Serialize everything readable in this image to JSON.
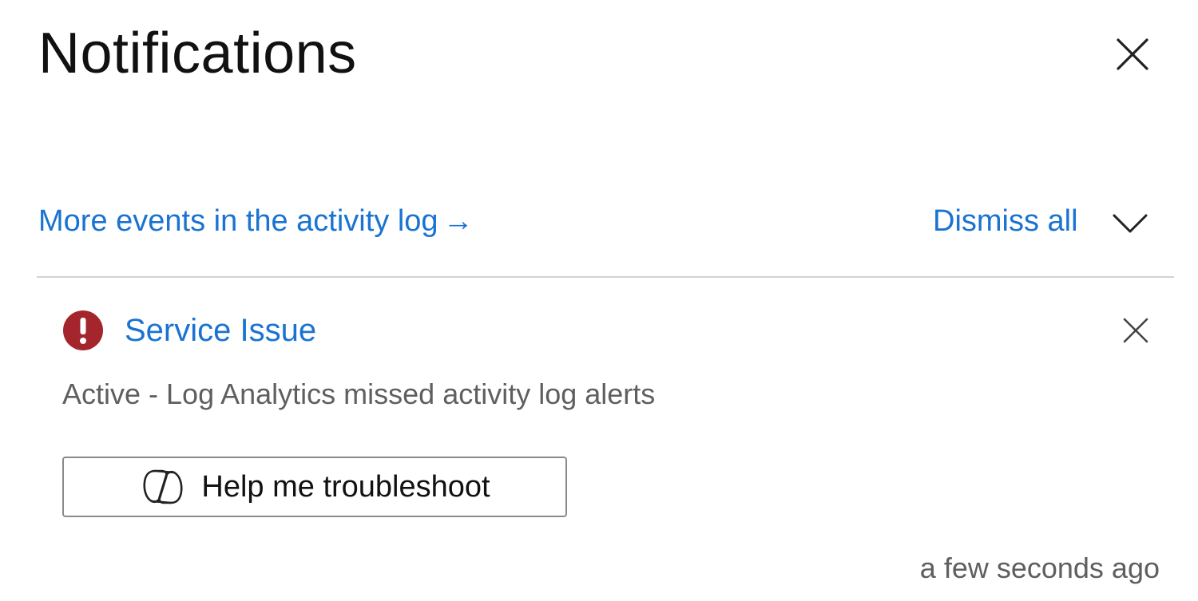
{
  "panel": {
    "title": "Notifications"
  },
  "toolbar": {
    "activity_link_label": "More events in the activity log",
    "activity_link_arrow": "→",
    "dismiss_all_label": "Dismiss all"
  },
  "notifications": [
    {
      "severity": "error",
      "title": "Service Issue",
      "description": "Active - Log Analytics missed activity log alerts",
      "action_label": "Help me troubleshoot",
      "timestamp": "a few seconds ago"
    }
  ],
  "colors": {
    "link": "#1a73d1",
    "error": "#a4262c",
    "muted_text": "#5f5f5f",
    "divider": "#d2d2d2"
  },
  "icons": {
    "panel_close": "close-icon",
    "collapse": "chevron-down-icon",
    "severity": "error-icon",
    "item_close": "close-icon",
    "action": "copilot-icon"
  }
}
